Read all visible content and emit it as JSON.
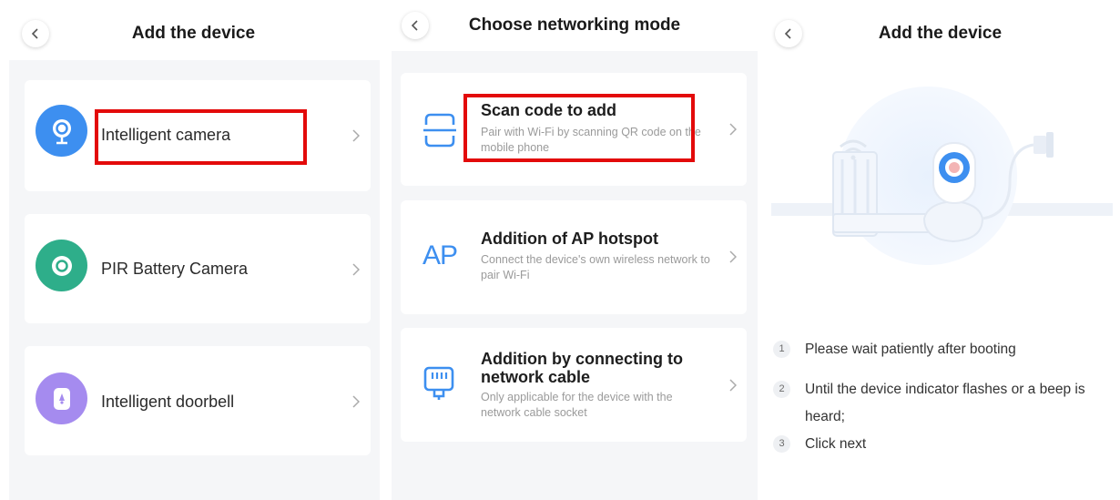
{
  "panel1": {
    "title": "Add the device",
    "devices": [
      {
        "label": "Intelligent camera",
        "icon": "camera-icon",
        "color": "#3d8ff0"
      },
      {
        "label": "PIR Battery Camera",
        "icon": "pir-camera-icon",
        "color": "#2eae8a"
      },
      {
        "label": "Intelligent doorbell",
        "icon": "doorbell-icon",
        "color": "#a58bef"
      }
    ]
  },
  "panel2": {
    "title": "Choose networking mode",
    "modes": [
      {
        "title": "Scan code to add",
        "desc": "Pair with Wi-Fi by scanning QR code on the mobile phone",
        "icon": "scan-icon"
      },
      {
        "title": "Addition of AP hotspot",
        "desc": "Connect the device's own wireless network to pair Wi-Fi",
        "icon": "ap-icon",
        "icon_text": "AP"
      },
      {
        "title": "Addition by connecting to network cable",
        "desc": "Only applicable for the device with the network cable socket",
        "icon": "ethernet-icon"
      }
    ]
  },
  "panel3": {
    "title": "Add the device",
    "illustration": "camera-router-illustration",
    "steps": [
      {
        "num": "1",
        "text": "Please wait patiently after booting"
      },
      {
        "num": "2",
        "text": "Until the device indicator flashes or a beep is heard;"
      },
      {
        "num": "3",
        "text": "Click next"
      }
    ]
  },
  "colors": {
    "accent": "#3d8ff0",
    "highlight": "#e30a0a",
    "background": "#f5f6f8"
  }
}
